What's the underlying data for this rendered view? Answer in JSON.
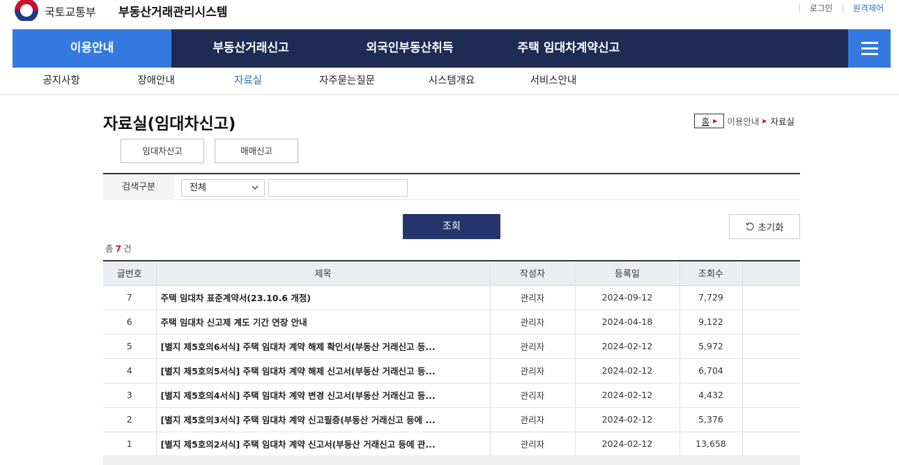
{
  "header": {
    "ministry": "국토교통부",
    "system_title": "부동산거래관리시스템",
    "login": "로그인",
    "remote": "원격제어"
  },
  "gnb": {
    "items": [
      "이용안내",
      "부동산거래신고",
      "외국인부동산취득",
      "주택 임대차계약신고"
    ],
    "active": "이용안내"
  },
  "lnb": {
    "items": [
      "공지사항",
      "장애안내",
      "자료실",
      "자주묻는질문",
      "시스템개요",
      "서비스안내"
    ],
    "active": "자료실"
  },
  "page": {
    "title": "자료실(임대차신고)",
    "breadcrumb": {
      "home": "홈",
      "parent": "이용안내",
      "current": "자료실"
    },
    "tabs": [
      "임대차신고",
      "매매신고"
    ]
  },
  "search": {
    "label": "검색구분",
    "select_value": "전체",
    "input_value": "",
    "search_button": "조회",
    "reset_button": "초기화"
  },
  "total": {
    "prefix": "총",
    "count": "7",
    "suffix": "건"
  },
  "table": {
    "columns": [
      "글번호",
      "제목",
      "작성자",
      "등록일",
      "조회수"
    ],
    "rows": [
      {
        "no": "7",
        "title": "주택 임대차 표준계약서(23.10.6 개정)",
        "author": "관리자",
        "date": "2024-09-12",
        "views": "7,729"
      },
      {
        "no": "6",
        "title": "주택 임대차 신고제 계도 기간 연장 안내",
        "author": "관리자",
        "date": "2024-04-18",
        "views": "9,122"
      },
      {
        "no": "5",
        "title": "[별지 제5호의6서식] 주택 임대차 계약 해제 확인서(부동산 거래신고 등...",
        "author": "관리자",
        "date": "2024-02-12",
        "views": "5,972"
      },
      {
        "no": "4",
        "title": "[별지 제5호의5서식] 주택 임대차 계약 해제 신고서(부동산 거래신고 등...",
        "author": "관리자",
        "date": "2024-02-12",
        "views": "6,704"
      },
      {
        "no": "3",
        "title": "[별지 제5호의4서식] 주택 임대차 계약 변경 신고서(부동산 거래신고 등...",
        "author": "관리자",
        "date": "2024-02-12",
        "views": "4,432"
      },
      {
        "no": "2",
        "title": "[별지 제5호의3서식] 주택 임대차 계약 신고필증(부동산 거래신고 등에 ...",
        "author": "관리자",
        "date": "2024-02-12",
        "views": "5,376"
      },
      {
        "no": "1",
        "title": "[별지 제5호의2서식] 주택 임대차 계약 신고서(부동산 거래신고 등에 관...",
        "author": "관리자",
        "date": "2024-02-12",
        "views": "13,658"
      }
    ]
  },
  "colors": {
    "navy": "#1e2b52",
    "accent_blue": "#3479e0",
    "button_navy": "#24366d",
    "highlight_red": "#c8102e"
  }
}
